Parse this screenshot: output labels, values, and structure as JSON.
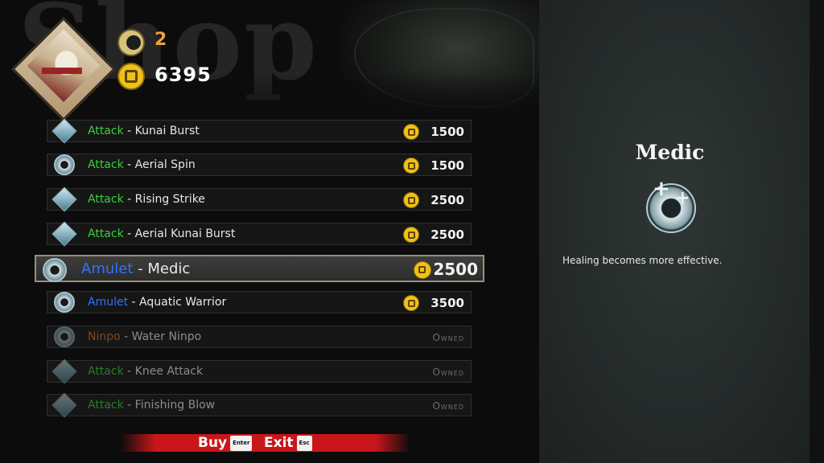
{
  "header": {
    "watermark": "Shop",
    "moon_currency": "2",
    "gold": "6395"
  },
  "items": [
    {
      "category": "Attack",
      "name": "Kunai Burst",
      "price": "1500",
      "owned": false
    },
    {
      "category": "Attack",
      "name": "Aerial Spin",
      "price": "1500",
      "owned": false
    },
    {
      "category": "Attack",
      "name": "Rising Strike",
      "price": "2500",
      "owned": false
    },
    {
      "category": "Attack",
      "name": "Aerial Kunai Burst",
      "price": "2500",
      "owned": false
    },
    {
      "category": "Amulet",
      "name": "Medic",
      "price": "2500",
      "owned": false,
      "selected": true
    },
    {
      "category": "Amulet",
      "name": "Aquatic Warrior",
      "price": "3500",
      "owned": false
    },
    {
      "category": "Ninpo",
      "name": "Water Ninpo",
      "status": "Owned",
      "owned": true
    },
    {
      "category": "Attack",
      "name": "Knee Attack",
      "status": "Owned",
      "owned": true
    },
    {
      "category": "Attack",
      "name": "Finishing Blow",
      "status": "Owned",
      "owned": true
    }
  ],
  "separator": " - ",
  "actions": {
    "buy_label": "Buy",
    "buy_key": "Enter",
    "exit_label": "Exit",
    "exit_key": "Esc"
  },
  "detail": {
    "title": "Medic",
    "description": "Healing becomes more effective."
  },
  "colors": {
    "attack": "#3ad13a",
    "amulet": "#2f73ff",
    "ninpo": "#d0702a",
    "bar": "#c8161a"
  }
}
